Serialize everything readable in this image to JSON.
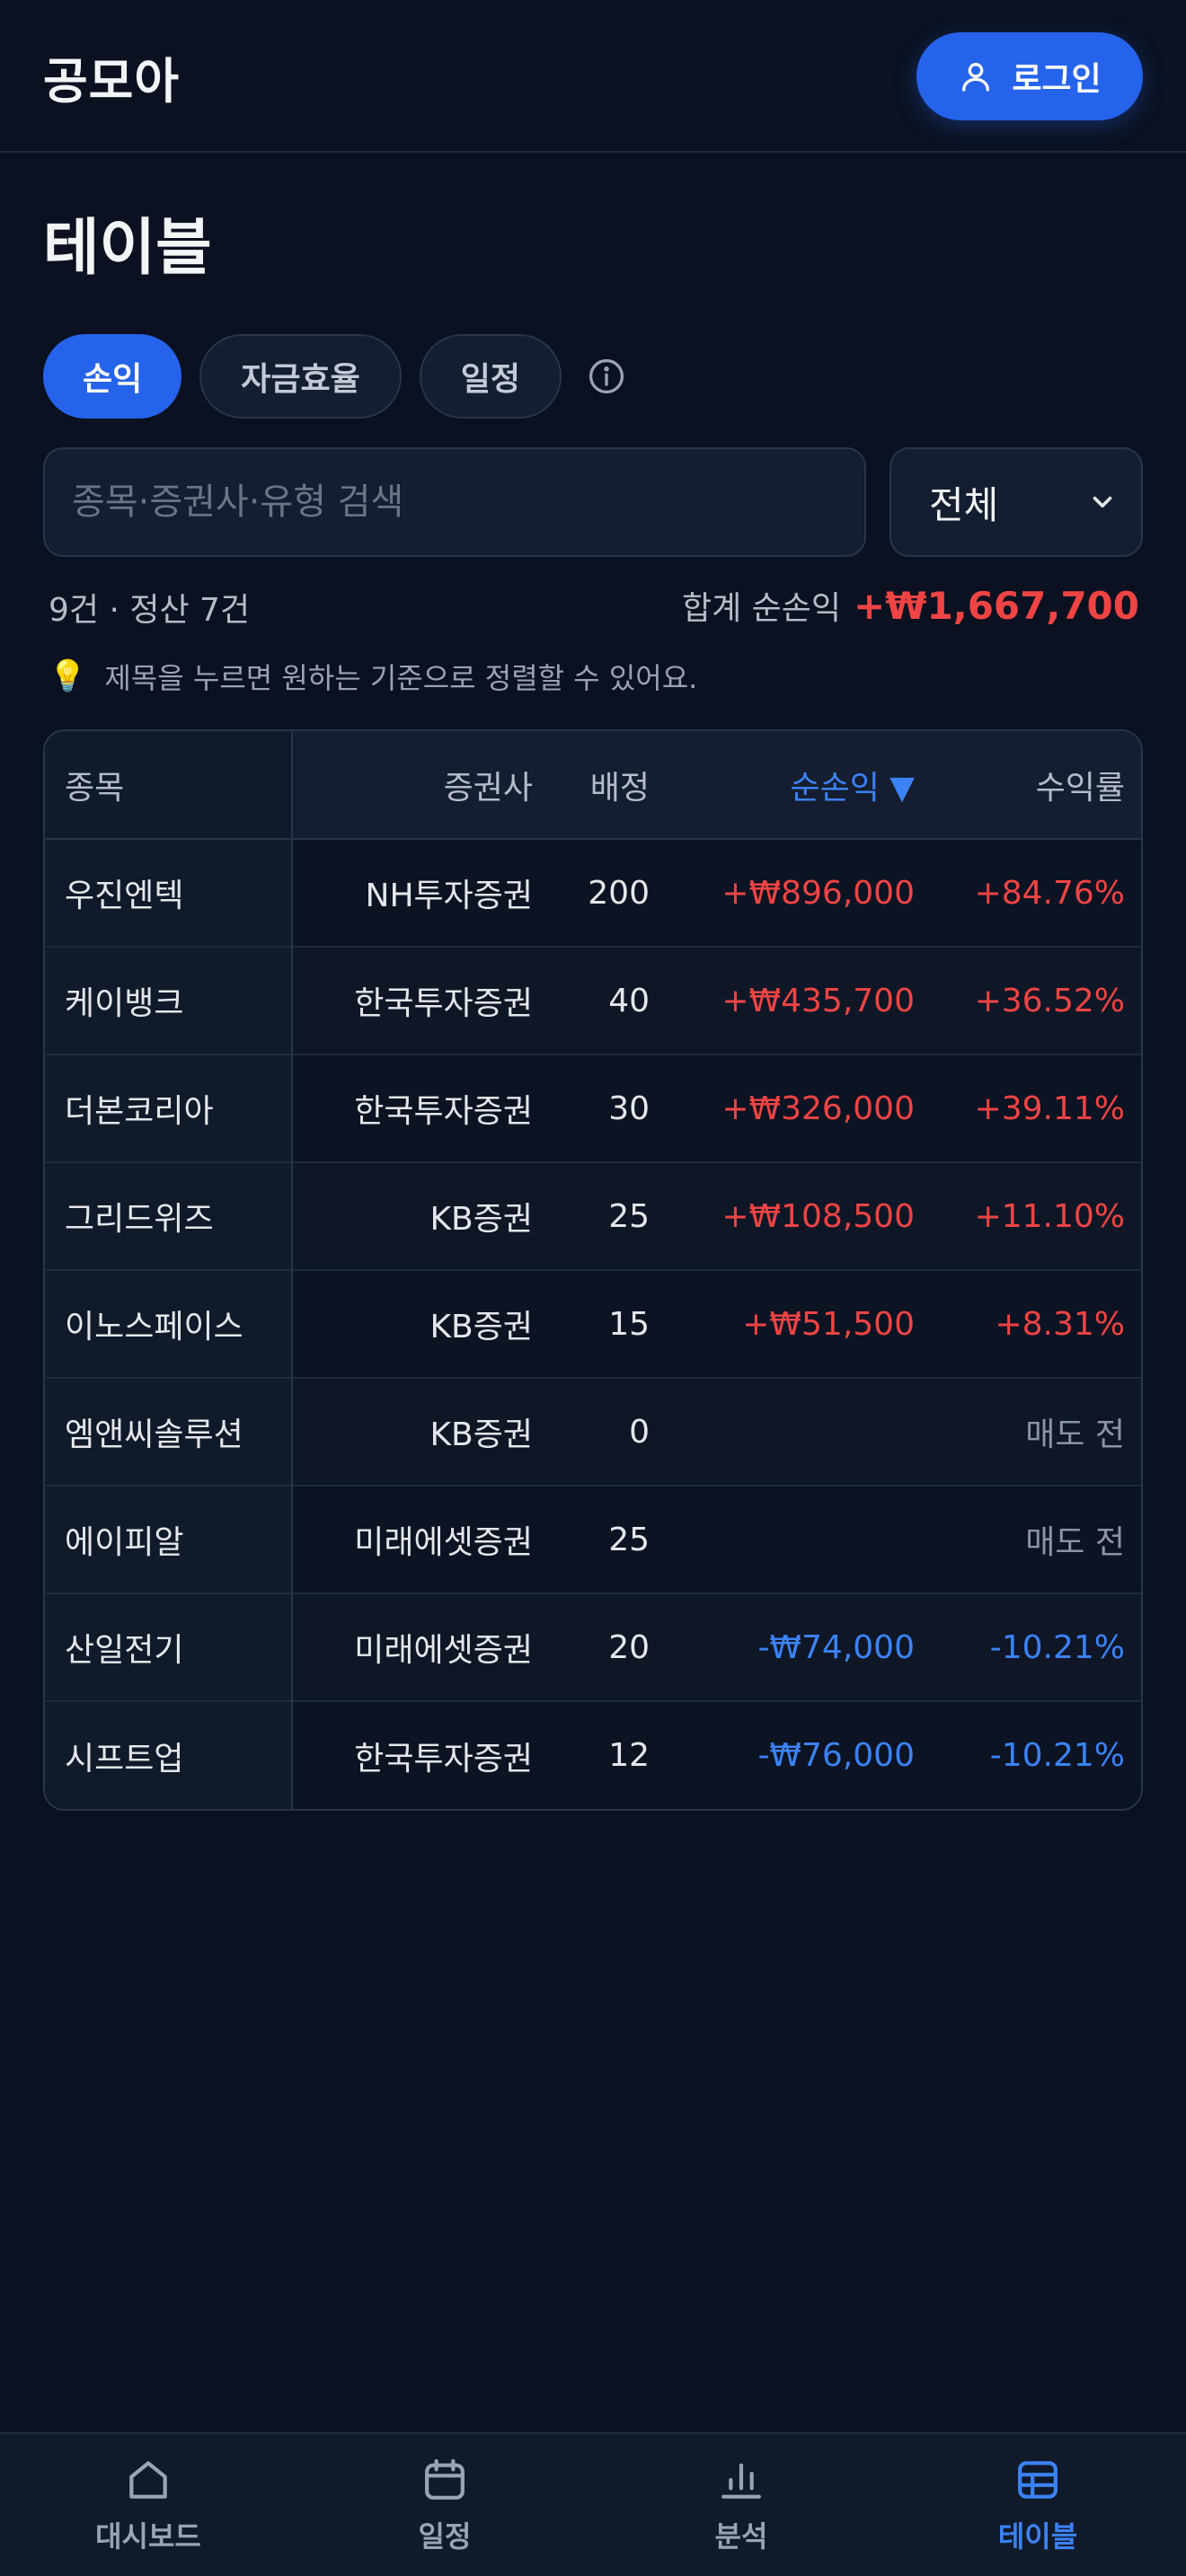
{
  "header": {
    "app_title": "공모아",
    "login_label": "로그인"
  },
  "page": {
    "title": "테이블"
  },
  "tabs": [
    {
      "label": "손익",
      "active": true
    },
    {
      "label": "자금효율",
      "active": false
    },
    {
      "label": "일정",
      "active": false
    }
  ],
  "search": {
    "placeholder": "종목·증권사·유형 검색",
    "value": ""
  },
  "filter": {
    "selected": "전체"
  },
  "summary": {
    "count_text": "9건 · 정산 7건",
    "total_label": "합계 순손익",
    "total_value": "+₩1,667,700"
  },
  "tip": {
    "text": "제목을 누르면 원하는 기준으로 정렬할 수 있어요."
  },
  "table": {
    "headers": {
      "name": "종목",
      "broker": "증권사",
      "allocation": "배정",
      "pnl": "순손익 ▼",
      "rate": "수익률"
    },
    "rows": [
      {
        "name": "우진엔텍",
        "broker": "NH투자증권",
        "allocation": "200",
        "pnl": "+₩896,000",
        "rate": "+84.76%",
        "status": "pos"
      },
      {
        "name": "케이뱅크",
        "broker": "한국투자증권",
        "allocation": "40",
        "pnl": "+₩435,700",
        "rate": "+36.52%",
        "status": "pos"
      },
      {
        "name": "더본코리아",
        "broker": "한국투자증권",
        "allocation": "30",
        "pnl": "+₩326,000",
        "rate": "+39.11%",
        "status": "pos"
      },
      {
        "name": "그리드위즈",
        "broker": "KB증권",
        "allocation": "25",
        "pnl": "+₩108,500",
        "rate": "+11.10%",
        "status": "pos"
      },
      {
        "name": "이노스페이스",
        "broker": "KB증권",
        "allocation": "15",
        "pnl": "+₩51,500",
        "rate": "+8.31%",
        "status": "pos"
      },
      {
        "name": "엠앤씨솔루션",
        "broker": "KB증권",
        "allocation": "0",
        "pnl": "",
        "rate": "매도 전",
        "status": "muted"
      },
      {
        "name": "에이피알",
        "broker": "미래에셋증권",
        "allocation": "25",
        "pnl": "",
        "rate": "매도 전",
        "status": "muted"
      },
      {
        "name": "산일전기",
        "broker": "미래에셋증권",
        "allocation": "20",
        "pnl": "-₩74,000",
        "rate": "-10.21%",
        "status": "neg"
      },
      {
        "name": "시프트업",
        "broker": "한국투자증권",
        "allocation": "12",
        "pnl": "-₩76,000",
        "rate": "-10.21%",
        "status": "neg"
      }
    ]
  },
  "nav": [
    {
      "label": "대시보드",
      "icon": "home-icon",
      "active": false
    },
    {
      "label": "일정",
      "icon": "calendar-icon",
      "active": false
    },
    {
      "label": "분석",
      "icon": "bar-chart-icon",
      "active": false
    },
    {
      "label": "테이블",
      "icon": "table-icon",
      "active": true
    }
  ],
  "colors": {
    "accent": "#2563eb",
    "positive": "#ef4444",
    "negative": "#3b82f6",
    "background": "#0b1120"
  }
}
